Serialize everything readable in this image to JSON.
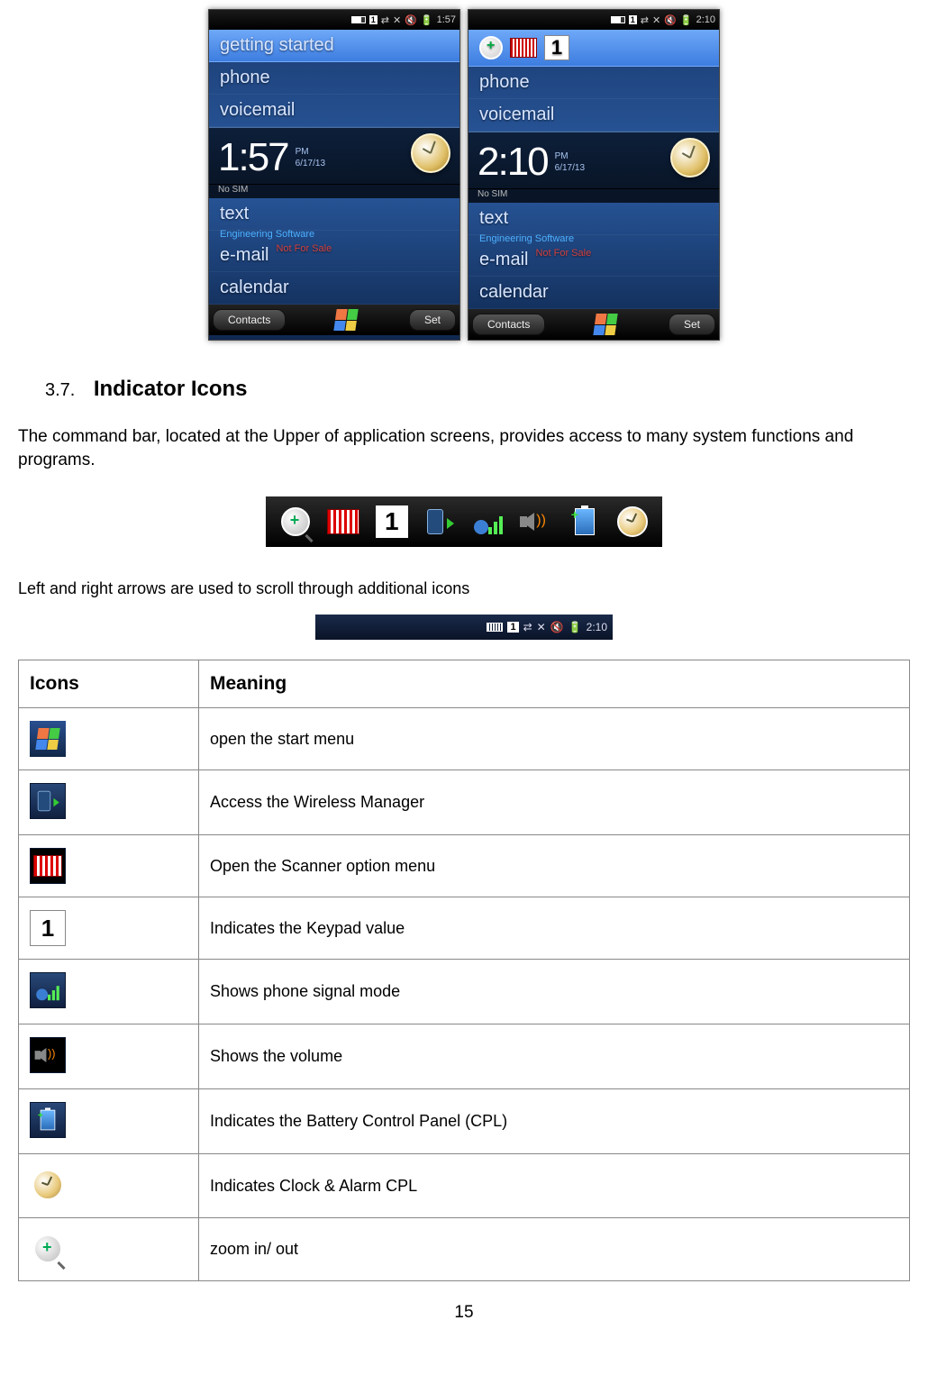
{
  "screens": {
    "left": {
      "topbar_time": "1:57",
      "selected_label": "getting started",
      "items": [
        "phone",
        "voicemail"
      ],
      "big_time": "1:57",
      "ampm": "PM",
      "date": "6/17/13",
      "nosim": "No SIM",
      "lower_items": [
        "text",
        "e-mail",
        "calendar"
      ],
      "watermark1": "Engineering Software",
      "watermark2": "Not For Sale",
      "soft_left": "Contacts",
      "soft_right": "Set"
    },
    "right": {
      "topbar_time": "2:10",
      "selected_icons": [
        "zoom",
        "barcode",
        "one"
      ],
      "items": [
        "phone",
        "voicemail"
      ],
      "big_time": "2:10",
      "ampm": "PM",
      "date": "6/17/13",
      "nosim": "No SIM",
      "lower_items": [
        "text",
        "e-mail",
        "calendar"
      ],
      "watermark1": "Engineering Software",
      "watermark2": "Not For Sale",
      "soft_left": "Contacts",
      "soft_right": "Set"
    }
  },
  "section": {
    "num": "3.7.",
    "title": "Indicator Icons"
  },
  "para1": "The command bar, located at the Upper of application screens, provides access to many system functions and programs.",
  "para2": "Left and right arrows are used to scroll through additional icons",
  "statusbar_time": "2:10",
  "table": {
    "h1": "Icons",
    "h2": "Meaning",
    "rows": [
      {
        "icon": "start",
        "meaning": "open the start menu"
      },
      {
        "icon": "wireless",
        "meaning": "Access the Wireless Manager"
      },
      {
        "icon": "barcode",
        "meaning": "Open the Scanner option menu"
      },
      {
        "icon": "one",
        "meaning": "Indicates the Keypad value"
      },
      {
        "icon": "signal",
        "meaning": "Shows phone signal mode"
      },
      {
        "icon": "volume",
        "meaning": "Shows the volume"
      },
      {
        "icon": "battery",
        "meaning": "Indicates the Battery Control Panel (CPL)"
      },
      {
        "icon": "clock",
        "meaning": "Indicates Clock & Alarm CPL"
      },
      {
        "icon": "zoom",
        "meaning": "zoom in/ out"
      }
    ]
  },
  "page_number": "15"
}
